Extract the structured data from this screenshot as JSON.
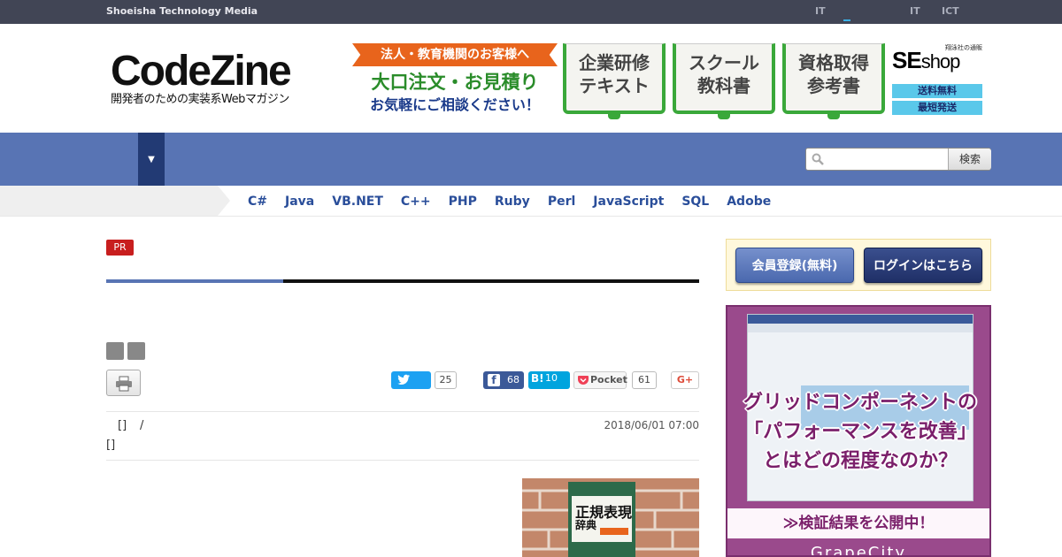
{
  "topbar": {
    "brand": "Shoeisha Technology Media",
    "links": [
      "IT",
      "IT",
      "ICT"
    ]
  },
  "header": {
    "logo_main": "CodeZine",
    "logo_sub": "開発者のための実装系Webマガジン",
    "banner": {
      "ribbon": "法人・教育機関のお客様へ",
      "line1": "大口注文・お見積り",
      "line2": "お気軽にご相談ください！",
      "books": [
        {
          "l1": "企業研修",
          "l2": "テキスト"
        },
        {
          "l1": "スクール",
          "l2": "教科書"
        },
        {
          "l1": "資格取得",
          "l2": "参考書"
        }
      ],
      "seshop_small": "翔泳社の通販",
      "seshop_name": "SE",
      "seshop_name2": "shop",
      "seshop_pill1": "送料無料",
      "seshop_pill2": "最短発送"
    }
  },
  "nav": {
    "dropdown_glyph": "▼",
    "search_placeholder": "",
    "search_button": "検索"
  },
  "langs": [
    "C#",
    "Java",
    "VB.NET",
    "C++",
    "PHP",
    "Ruby",
    "Perl",
    "JavaScript",
    "SQL",
    "Adobe"
  ],
  "article": {
    "badge": "PR",
    "share": {
      "twitter_count": "25",
      "facebook_count": "68",
      "hatena_label": "B!",
      "hatena_count": "10",
      "pocket_label": "Pocket",
      "pocket_count": "61",
      "gplus_label": "G+"
    },
    "meta_a1": "[]",
    "meta_a2": "/",
    "meta_a3": "[]",
    "date": "2018/06/01 07:00",
    "book_title": "正規表現",
    "book_sub": "辞典"
  },
  "sidebar": {
    "register_button": "会員登録(無料)",
    "login_button": "ログインはこちら",
    "ad_line1": "グリッドコンポーネントの",
    "ad_line2": "「パフォーマンスを改善」",
    "ad_line3": "とはどの程度なのか？",
    "ad_cta": "≫検証結果を公開中！",
    "ad_brand": "GrapeCity"
  },
  "colors": {
    "topbar": "#414555",
    "nav": "#5874b4",
    "nav_dark": "#223a74",
    "link": "#2a4e9a",
    "pr": "#c81e1e"
  }
}
